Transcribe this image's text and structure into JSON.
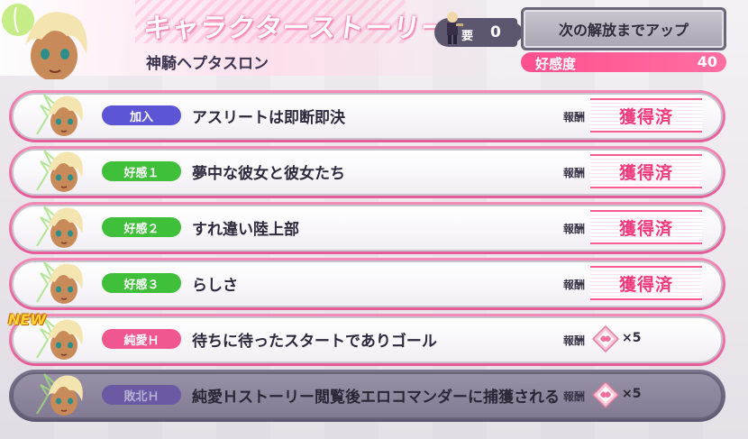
{
  "header": {
    "title": "キャラクターストーリー",
    "character_name": "神騎ヘプタスロン",
    "requirement": {
      "label": "要",
      "value": "0"
    },
    "unlock_button": "次の解放までアップ",
    "affinity": {
      "label": "好感度",
      "value": "40"
    }
  },
  "reward_label": "報酬",
  "stories": [
    {
      "tag": "加入",
      "tag_type": "join",
      "title": "アスリートは即断即決",
      "reward": "獲得済",
      "reward_type": "obtained",
      "is_new": false,
      "locked": false
    },
    {
      "tag": "好感１",
      "tag_type": "aff",
      "title": "夢中な彼女と彼女たち",
      "reward": "獲得済",
      "reward_type": "obtained",
      "is_new": false,
      "locked": false
    },
    {
      "tag": "好感２",
      "tag_type": "aff",
      "title": "すれ違い陸上部",
      "reward": "獲得済",
      "reward_type": "obtained",
      "is_new": false,
      "locked": false
    },
    {
      "tag": "好感３",
      "tag_type": "aff",
      "title": "らしさ",
      "reward": "獲得済",
      "reward_type": "obtained",
      "is_new": false,
      "locked": false
    },
    {
      "tag": "純愛Ｈ",
      "tag_type": "pure",
      "title": "待ちに待ったスタートでありゴール",
      "reward": "×5",
      "reward_type": "gem",
      "is_new": true,
      "new_label": "NEW",
      "locked": false
    },
    {
      "tag": "敗北Ｈ",
      "tag_type": "defeat",
      "title": "純愛Ｈストーリー閲覧後エロコマンダーに捕獲される",
      "reward": "×5",
      "reward_type": "gem",
      "is_new": false,
      "locked": true
    }
  ],
  "colors": {
    "accent_pink": "#f0568f",
    "tag_join": "#5c56d6",
    "tag_affinity": "#3fbf3a",
    "tag_pure": "#f0568f",
    "tag_defeat": "#6b5aa3"
  }
}
